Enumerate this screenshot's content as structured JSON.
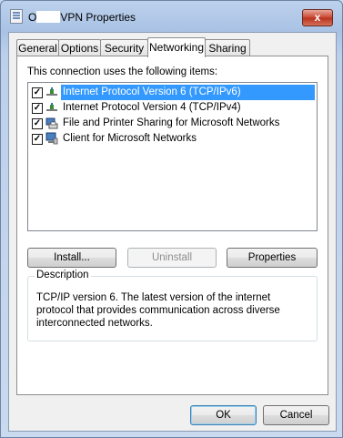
{
  "window": {
    "title_prefix": "O",
    "title_suffix": "VPN Properties",
    "close_label": "x"
  },
  "tabs": [
    {
      "label": "General",
      "active": false
    },
    {
      "label": "Options",
      "active": false
    },
    {
      "label": "Security",
      "active": false
    },
    {
      "label": "Networking",
      "active": true
    },
    {
      "label": "Sharing",
      "active": false
    }
  ],
  "networking": {
    "items_label": "This connection uses the following items:",
    "items": [
      {
        "label": "Internet Protocol Version 6 (TCP/IPv6)",
        "checked": true,
        "selected": true,
        "icon": "protocol-icon"
      },
      {
        "label": "Internet Protocol Version 4 (TCP/IPv4)",
        "checked": true,
        "selected": false,
        "icon": "protocol-icon"
      },
      {
        "label": "File and Printer Sharing for Microsoft Networks",
        "checked": true,
        "selected": false,
        "icon": "service-icon"
      },
      {
        "label": "Client for Microsoft Networks",
        "checked": true,
        "selected": false,
        "icon": "client-icon"
      }
    ],
    "install_label": "Install...",
    "uninstall_label": "Uninstall",
    "properties_label": "Properties",
    "description_title": "Description",
    "description_text": "TCP/IP version 6. The latest version of the internet protocol that provides communication across diverse interconnected networks."
  },
  "footer": {
    "ok_label": "OK",
    "cancel_label": "Cancel"
  },
  "colors": {
    "selection": "#3399ff",
    "window_frame": "#a9c2e4",
    "close_button": "#c8452f"
  }
}
